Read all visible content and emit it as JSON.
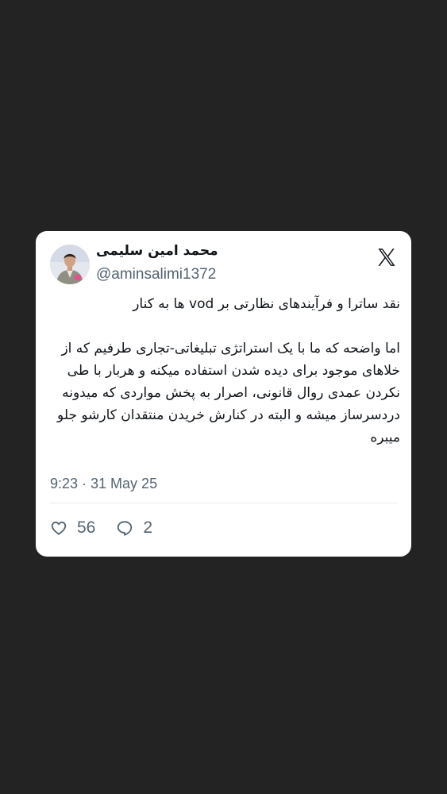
{
  "tweet": {
    "author": {
      "display_name": "محمد امین سلیمی",
      "handle": "@aminsalimi1372",
      "avatar_icon": "profile-photo"
    },
    "brand_icon": "x-logo-icon",
    "paragraphs": [
      "نقد ساترا و فرآیندهای نظارتی بر vod ها به کنار",
      "اما واضحه که ما با یک استراتژی تبلیغاتی-تجاری طرفیم که از خلاهای موجود برای دیده شدن استفاده میکنه و هربار با طی نکردن عمدی روال قانونی، اصرار به پخش مواردی که میدونه دردسرساز میشه و البته در کنارش خریدن منتقدان کارشو جلو میبره"
    ],
    "timestamp": "9:23 · 31 May 25",
    "likes": "56",
    "replies": "2"
  },
  "colors": {
    "background": "#232323",
    "card": "#ffffff",
    "text_primary": "#0f1419",
    "text_secondary": "#536471"
  }
}
